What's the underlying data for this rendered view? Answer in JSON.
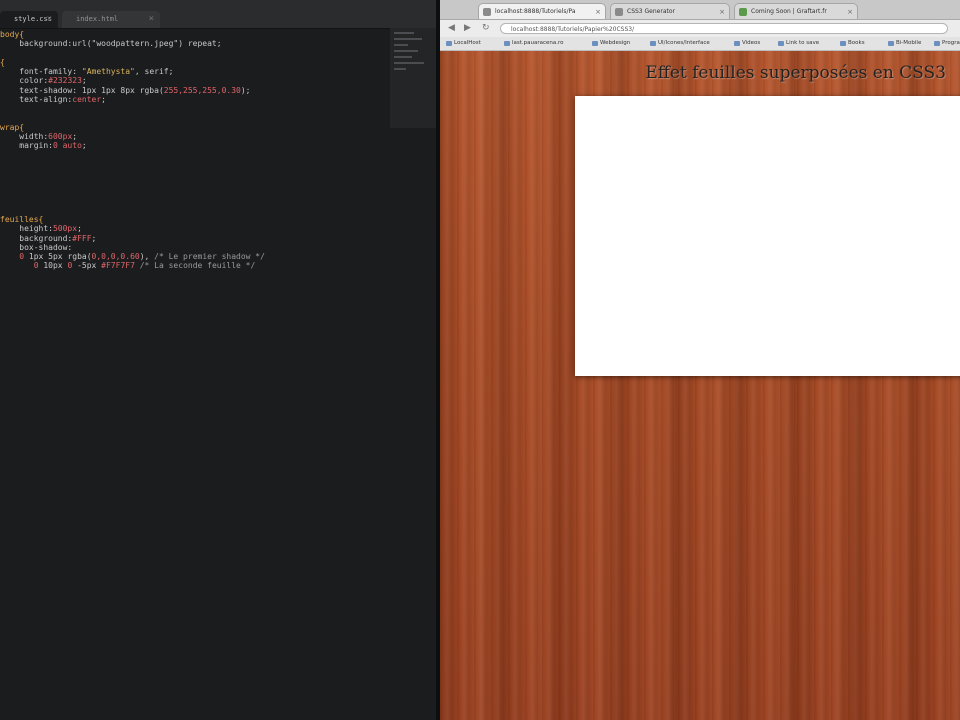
{
  "editor": {
    "tabs": [
      {
        "label": "style.css"
      },
      {
        "label": "index.html"
      }
    ],
    "code": [
      {
        "t": [
          {
            "c": "sel",
            "v": "body{"
          }
        ]
      },
      {
        "t": [
          {
            "c": "prop",
            "v": "    background:url(\"woodpattern.jpeg\") repeat;"
          }
        ]
      },
      {
        "t": [
          {
            "c": "prop",
            "v": ""
          }
        ]
      },
      {
        "t": [
          {
            "c": "sel",
            "v": "{"
          }
        ]
      },
      {
        "t": [
          {
            "c": "prop",
            "v": "    font-family: "
          },
          {
            "c": "str",
            "v": "\"Amethysta\""
          },
          {
            "c": "prop",
            "v": ", serif;"
          }
        ]
      },
      {
        "t": [
          {
            "c": "prop",
            "v": "    color:"
          },
          {
            "c": "num",
            "v": "#232323"
          },
          {
            "c": "prop",
            "v": ";"
          }
        ]
      },
      {
        "t": [
          {
            "c": "prop",
            "v": "    text-shadow: 1px 1px 8px rgba("
          },
          {
            "c": "num",
            "v": "255,255,255,0.30"
          },
          {
            "c": "prop",
            "v": ");"
          }
        ]
      },
      {
        "t": [
          {
            "c": "prop",
            "v": "    text-align:"
          },
          {
            "c": "num",
            "v": "center"
          },
          {
            "c": "prop",
            "v": ";"
          }
        ]
      },
      {
        "t": [
          {
            "c": "prop",
            "v": ""
          }
        ]
      },
      {
        "t": [
          {
            "c": "prop",
            "v": ""
          }
        ]
      },
      {
        "t": [
          {
            "c": "sel",
            "v": "wrap{"
          }
        ]
      },
      {
        "t": [
          {
            "c": "prop",
            "v": "    width:"
          },
          {
            "c": "num",
            "v": "600px"
          },
          {
            "c": "prop",
            "v": ";"
          }
        ]
      },
      {
        "t": [
          {
            "c": "prop",
            "v": "    margin:"
          },
          {
            "c": "num",
            "v": "0 auto"
          },
          {
            "c": "prop",
            "v": ";"
          }
        ]
      },
      {
        "t": [
          {
            "c": "prop",
            "v": ""
          }
        ]
      },
      {
        "t": [
          {
            "c": "prop",
            "v": ""
          }
        ]
      },
      {
        "t": [
          {
            "c": "prop",
            "v": ""
          }
        ]
      },
      {
        "t": [
          {
            "c": "prop",
            "v": ""
          }
        ]
      },
      {
        "t": [
          {
            "c": "prop",
            "v": ""
          }
        ]
      },
      {
        "t": [
          {
            "c": "prop",
            "v": ""
          }
        ]
      },
      {
        "t": [
          {
            "c": "prop",
            "v": ""
          }
        ]
      },
      {
        "t": [
          {
            "c": "sel",
            "v": "feuilles{"
          }
        ]
      },
      {
        "t": [
          {
            "c": "prop",
            "v": "    height:"
          },
          {
            "c": "num",
            "v": "500px"
          },
          {
            "c": "prop",
            "v": ";"
          }
        ]
      },
      {
        "t": [
          {
            "c": "prop",
            "v": "    background:"
          },
          {
            "c": "num",
            "v": "#FFF"
          },
          {
            "c": "prop",
            "v": ";"
          }
        ]
      },
      {
        "t": [
          {
            "c": "prop",
            "v": "    box-shadow:"
          }
        ]
      },
      {
        "t": [
          {
            "c": "num",
            "v": "    0"
          },
          {
            "c": "prop",
            "v": " 1px 5px rgba("
          },
          {
            "c": "num",
            "v": "0,0,0,0.60"
          },
          {
            "c": "prop",
            "v": "), "
          },
          {
            "c": "cm",
            "v": "/* Le premier shadow */"
          }
        ]
      },
      {
        "t": [
          {
            "c": "num",
            "v": "       0"
          },
          {
            "c": "prop",
            "v": " 10px "
          },
          {
            "c": "num",
            "v": "0"
          },
          {
            "c": "prop",
            "v": " -5px "
          },
          {
            "c": "num",
            "v": "#F7F7F7"
          },
          {
            "c": "prop",
            "v": " "
          },
          {
            "c": "cm",
            "v": "/* La seconde feuille */"
          }
        ]
      }
    ]
  },
  "browser": {
    "tabs": [
      {
        "label": "localhost:8888/Tutoriels/Pa"
      },
      {
        "label": "CSS3 Generator"
      },
      {
        "label": "Coming Soon | Graftart.fr"
      }
    ],
    "url": "localhost:8888/Tutoriels/Papier%20CSS3/",
    "nav_back": "◀",
    "nav_forward": "▶",
    "nav_reload": "↻",
    "bookmarks": [
      {
        "label": "LocalHost"
      },
      {
        "label": "last.pauaracena.ro"
      },
      {
        "label": "Webdesign"
      },
      {
        "label": "UI/Icones/Interface"
      },
      {
        "label": "Videos"
      },
      {
        "label": "Link to save"
      },
      {
        "label": "Books"
      },
      {
        "label": "Bi-Mobile"
      },
      {
        "label": "Programming"
      }
    ],
    "page": {
      "title": "Effet feuilles superposées en CSS3"
    }
  }
}
